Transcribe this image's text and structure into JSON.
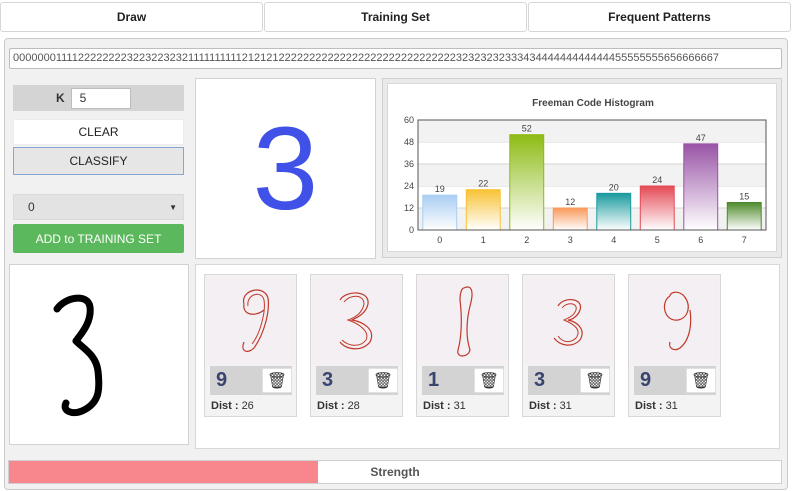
{
  "tabs": [
    {
      "label": "Draw"
    },
    {
      "label": "Training Set"
    },
    {
      "label": "Frequent Patterns"
    }
  ],
  "code_string": "000000011112222222232232232321111111111212121222222222222222222222222222223232323233343444444444444455555555656666667",
  "controls": {
    "k_label": "K",
    "k_value": "5",
    "clear_label": "CLEAR",
    "classify_label": "CLASSIFY",
    "training_label_selected": "0",
    "add_label": "ADD to TRAINING SET"
  },
  "classification": {
    "digit": "3",
    "digit_color": "#3f51e6"
  },
  "chart_data": {
    "type": "bar",
    "title": "Freeman Code Histogram",
    "categories": [
      "0",
      "1",
      "2",
      "3",
      "4",
      "5",
      "6",
      "7"
    ],
    "values": [
      19,
      22,
      52,
      12,
      20,
      24,
      47,
      15
    ],
    "ylim": [
      0,
      60
    ],
    "yticks": [
      0,
      12,
      24,
      36,
      48,
      60
    ],
    "colors": [
      "#a9cdf2",
      "#f8c235",
      "#8dbb14",
      "#f9995a",
      "#1a9a9e",
      "#e44a56",
      "#9954a6",
      "#4e8a2c"
    ],
    "grid": true
  },
  "neighbors": [
    {
      "label": "9",
      "dist_label": "Dist :",
      "dist": "26"
    },
    {
      "label": "3",
      "dist_label": "Dist :",
      "dist": "28"
    },
    {
      "label": "1",
      "dist_label": "Dist :",
      "dist": "31"
    },
    {
      "label": "3",
      "dist_label": "Dist :",
      "dist": "31"
    },
    {
      "label": "9",
      "dist_label": "Dist :",
      "dist": "31"
    }
  ],
  "strength": {
    "label": "Strength",
    "fraction": 0.4,
    "color": "#f7878c"
  }
}
